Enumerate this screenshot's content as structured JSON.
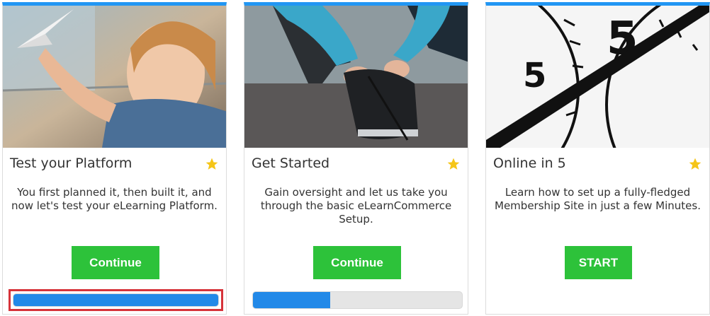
{
  "colors": {
    "accent_top": "#2196f3",
    "button_green": "#2dc23a",
    "progress_blue": "#2289e8",
    "highlight_red": "#d6333a",
    "star_yellow": "#f5c518"
  },
  "cards": [
    {
      "title": "Test your Platform",
      "description": "You first planned it, then built it, and now let's test your eLearning Platform.",
      "button_label": "Continue",
      "progress_percent": 100,
      "progress_highlighted": true,
      "image": "girl-with-paper-plane",
      "star_icon": "star-icon"
    },
    {
      "title": "Get Started",
      "description": "Gain oversight and let us take you through the basic eLearnCommerce Setup.",
      "button_label": "Continue",
      "progress_percent": 37,
      "progress_highlighted": false,
      "image": "tying-running-shoe",
      "star_icon": "star-icon"
    },
    {
      "title": "Online in 5",
      "description": "Learn how to set up a fully-fledged Membership Site in just a few Minutes.",
      "button_label": "START",
      "image": "stopwatch-closeup",
      "star_icon": "star-icon"
    }
  ]
}
